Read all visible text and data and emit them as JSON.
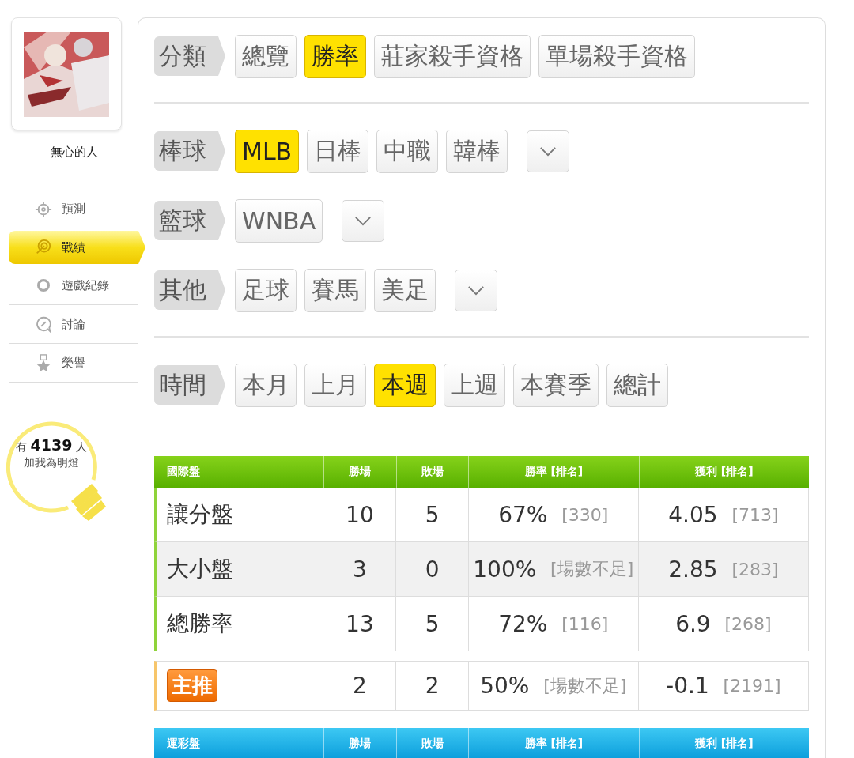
{
  "sidebar": {
    "username": "無心的人",
    "menu": [
      {
        "label": "預測",
        "selected": false
      },
      {
        "label": "戰績",
        "selected": true
      },
      {
        "label": "遊戲紀錄",
        "selected": false
      },
      {
        "label": "討論",
        "selected": false
      },
      {
        "label": "榮譽",
        "selected": false
      }
    ],
    "followers": {
      "prefix": "有",
      "count": "4139",
      "suffix": "人",
      "caption": "加我為明燈"
    }
  },
  "filter_sections": [
    [
      {
        "label": "分類",
        "options": [
          {
            "label": "總覽",
            "selected": false
          },
          {
            "label": "勝率",
            "selected": true
          },
          {
            "label": "莊家殺手資格",
            "selected": false
          },
          {
            "label": "單場殺手資格",
            "selected": false
          }
        ],
        "more": false
      }
    ],
    [
      {
        "label": "棒球",
        "options": [
          {
            "label": "MLB",
            "selected": true
          },
          {
            "label": "日棒",
            "selected": false
          },
          {
            "label": "中職",
            "selected": false
          },
          {
            "label": "韓棒",
            "selected": false
          }
        ],
        "more": true
      },
      {
        "label": "籃球",
        "options": [
          {
            "label": "WNBA",
            "selected": false
          }
        ],
        "more": true
      },
      {
        "label": "其他",
        "options": [
          {
            "label": "足球",
            "selected": false
          },
          {
            "label": "賽馬",
            "selected": false
          },
          {
            "label": "美足",
            "selected": false
          }
        ],
        "more": true
      }
    ],
    [
      {
        "label": "時間",
        "options": [
          {
            "label": "本月",
            "selected": false
          },
          {
            "label": "上月",
            "selected": false
          },
          {
            "label": "本週",
            "selected": true
          },
          {
            "label": "上週",
            "selected": false
          },
          {
            "label": "本賽季",
            "selected": false
          },
          {
            "label": "總計",
            "selected": false
          }
        ],
        "more": false
      }
    ]
  ],
  "tables": [
    {
      "kind": "international",
      "columns": [
        "國際盤",
        "勝場",
        "敗場",
        "勝率 [排名]",
        "獲利 [排名]"
      ],
      "rows": [
        {
          "name": "讓分盤",
          "wins": "10",
          "losses": "5",
          "rate": "67%",
          "rate_rank": "[330]",
          "profit": "4.05",
          "profit_rank": "[713]"
        },
        {
          "name": "大小盤",
          "wins": "3",
          "losses": "0",
          "rate": "100%",
          "rate_rank": "[場數不足]",
          "profit": "2.85",
          "profit_rank": "[283]"
        },
        {
          "name": "總勝率",
          "wins": "13",
          "losses": "5",
          "rate": "72%",
          "rate_rank": "[116]",
          "profit": "6.9",
          "profit_rank": "[268]"
        }
      ],
      "featured": {
        "badge": "主推",
        "wins": "2",
        "losses": "2",
        "rate": "50%",
        "rate_rank": "[場數不足]",
        "profit": "-0.1",
        "profit_rank": "[2191]"
      }
    },
    {
      "kind": "sports_lottery",
      "columns": [
        "運彩盤",
        "勝場",
        "敗場",
        "勝率 [排名]",
        "獲利 [排名]"
      ]
    }
  ]
}
